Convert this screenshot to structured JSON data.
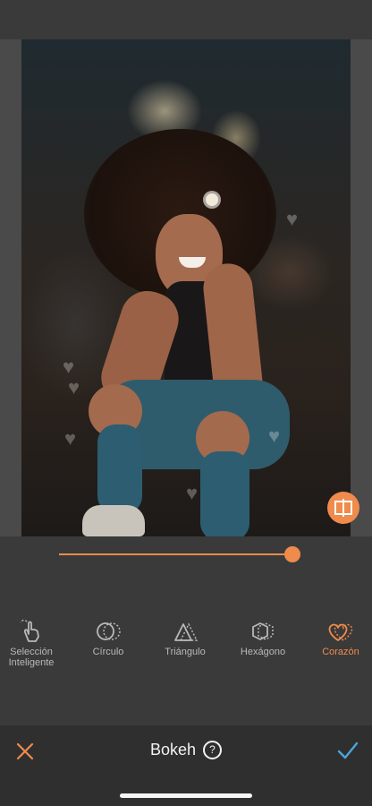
{
  "app": {
    "title": "Bokeh"
  },
  "colors": {
    "accent": "#ef8b4c",
    "background": "#3a3a3a",
    "bottom_bar": "#2f2f2f",
    "text": "#f2f2f2",
    "tool_text": "#b9b9b9"
  },
  "slider": {
    "value": 0.96
  },
  "tools": [
    {
      "label": "Selección\nInteligente",
      "icon": "hand-select-icon",
      "active": false
    },
    {
      "label": "Círculo",
      "icon": "circle-icon",
      "active": false
    },
    {
      "label": "Triángulo",
      "icon": "triangle-icon",
      "active": false
    },
    {
      "label": "Hexágono",
      "icon": "hexagon-icon",
      "active": false
    },
    {
      "label": "Corazón",
      "icon": "heart-icon",
      "active": true
    }
  ],
  "bottom": {
    "cancel_icon": "close-icon",
    "help_label": "?",
    "confirm_icon": "checkmark-icon"
  }
}
